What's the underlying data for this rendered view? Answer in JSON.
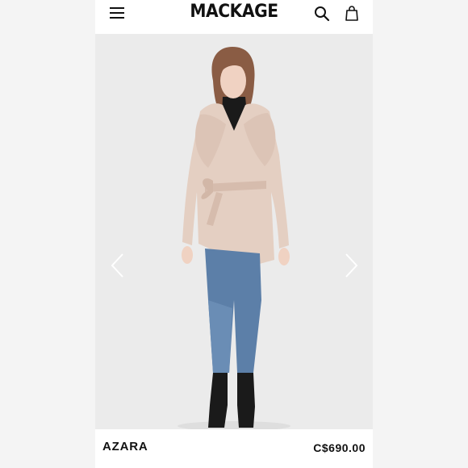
{
  "header": {
    "brand": "MACKAGE",
    "icons": [
      "menu-icon",
      "search-icon",
      "shopping-bag-icon"
    ]
  },
  "gallery": {
    "icons": [
      "chevron-left-icon",
      "chevron-right-icon"
    ]
  },
  "product": {
    "name": "AZARA",
    "price": "C$690.00"
  },
  "colors": {
    "background": "#ffffff",
    "outer_margin": "#f4f4f4",
    "hero_background": "#ebebeb",
    "coat": "#e4cfc2",
    "jeans": "#5c7fa8",
    "text": "#111111"
  }
}
